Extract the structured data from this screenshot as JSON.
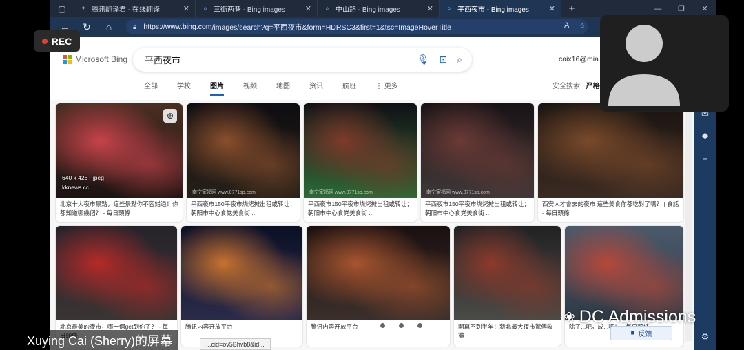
{
  "tabs": [
    {
      "title": "腾讯翻译君 - 在线翻译",
      "favicon": "translate-icon"
    },
    {
      "title": "三街两巷 - Bing images",
      "favicon": "search-icon"
    },
    {
      "title": "中山路 - Bing images",
      "favicon": "search-icon"
    },
    {
      "title": "平西夜市 - Bing images",
      "favicon": "search-icon",
      "active": true
    }
  ],
  "address": {
    "scheme": "https://",
    "host": "www.bing.com",
    "path": "/images/search?q=平西夜市&form=HDRSC3&first=1&tsc=ImageHoverTitle"
  },
  "bing": {
    "logo_text": "Microsoft Bing",
    "query": "平西夜市",
    "account": "caix16@mia",
    "scopes": [
      "全部",
      "学校",
      "图片",
      "视频",
      "地图",
      "资讯",
      "航班",
      "更多"
    ],
    "active_scope": "图片",
    "safesearch_label": "安全搜索:",
    "safesearch_value": "严格"
  },
  "results_row1": [
    {
      "caption": "北京十大夜市景點，這些景點你不容錯過！你都知道哪幾個？ - 每日頭條",
      "dims": "640 x 426 · jpeg",
      "source": "kknews.cc",
      "colors": [
        "#4b2e22",
        "#c7434b",
        "#1b1412"
      ]
    },
    {
      "caption": "平西夜市150平夜市烧烤摊出租或转让；朝阳市中心食党美食街 ...",
      "watermark": "南宁家福网 www.0771sp.com",
      "colors": [
        "#0f0d12",
        "#8a4f2c",
        "#262018"
      ]
    },
    {
      "caption": "平西夜市150平夜市烧烤摊出租或转让；朝阳市中心食党美食街 ...",
      "watermark": "南宁家福网 www.0771sp.com",
      "colors": [
        "#111015",
        "#7e3a2a",
        "#2d6a35"
      ]
    },
    {
      "caption": "平西夜市150平夜市烧烤摊出租或转让；朝阳市中心食党美食街 ...",
      "watermark": "南宁家福网 www.0771sp.com",
      "colors": [
        "#1a1316",
        "#6b3a35",
        "#3e3838"
      ]
    },
    {
      "caption": "西安人才會去的夜市 這些美食你都吃對了嗎？ | 食話 - 每日頭條",
      "colors": [
        "#1a1411",
        "#7a4a2a",
        "#3a2a22"
      ]
    }
  ],
  "results_row2": [
    {
      "caption": "北京最美的夜市，哪一個get到你了？ - 每日頭條",
      "colors": [
        "#26232b",
        "#b52a28",
        "#3a3433"
      ]
    },
    {
      "caption": "腾讯内容开放平台",
      "colors": [
        "#0b1026",
        "#c8722f",
        "#2a2b4a"
      ]
    },
    {
      "caption": "腾讯内容开放平台",
      "colors": [
        "#1b1010",
        "#a8552e",
        "#3b2f2b"
      ]
    },
    {
      "caption": "開幕不到半年！新北最大夜市驚傳收攤",
      "colors": [
        "#222224",
        "#8c3a2b",
        "#4a4a46"
      ]
    },
    {
      "caption": "除了...吧，成...嗎！ - 每日頭條",
      "colors": [
        "#4a5a6b",
        "#b6483a",
        "#2f3a44"
      ]
    }
  ],
  "overlay": {
    "rec_label": "REC",
    "presenter_name": "Xuying Cai (Sherry)的屏幕",
    "watermark_text": "DC Admissions",
    "feedback_label": "反馈",
    "status_url": "...cid=ov5Bhvb8&id..."
  }
}
